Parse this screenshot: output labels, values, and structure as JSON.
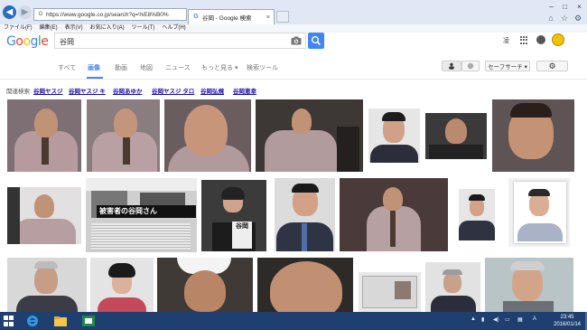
{
  "browser": {
    "url": "https://www.google.co.jp/search?q=%E8%B0%",
    "tab_title": "谷岡 - Google 検索",
    "tab_favicon": "G",
    "tab_close": "×",
    "window_min": "–",
    "window_max": "□",
    "window_close": "×",
    "menu": [
      "ファイル(F)",
      "編集(E)",
      "表示(V)",
      "お気に入り(A)",
      "ツール(T)",
      "ヘルプ(H)"
    ]
  },
  "google": {
    "logo_letters": [
      "G",
      "o",
      "o",
      "g",
      "l",
      "e"
    ],
    "query": "谷岡",
    "header_right_text": "凌"
  },
  "nav_tabs": [
    {
      "label": "すべて",
      "active": false
    },
    {
      "label": "画像",
      "active": true
    },
    {
      "label": "動画",
      "active": false
    },
    {
      "label": "地図",
      "active": false
    },
    {
      "label": "ニュース",
      "active": false
    },
    {
      "label": "もっと見る ▾",
      "active": false
    },
    {
      "label": "検索ツール",
      "active": false
    }
  ],
  "tools": {
    "safesearch_label": "セーフサーチ ▾"
  },
  "related": {
    "label": "関連検索:",
    "chips": [
      "谷岡ヤスジ",
      "谷岡ヤスジ キ",
      "谷岡あゆか",
      "谷岡ヤスジ タロ",
      "谷岡弘規",
      "谷岡恵幸"
    ]
  },
  "thumb_captions": {
    "newspaper_headline": "被害者の谷岡さん",
    "podium_sign": "谷岡"
  },
  "taskbar": {
    "time": "23:45",
    "date": "2016/01/14",
    "tray_lang": "A"
  },
  "colors": {
    "google_blue": "#4285f4",
    "link_blue": "#1a0dab",
    "taskbar": "#1e3f6f"
  }
}
